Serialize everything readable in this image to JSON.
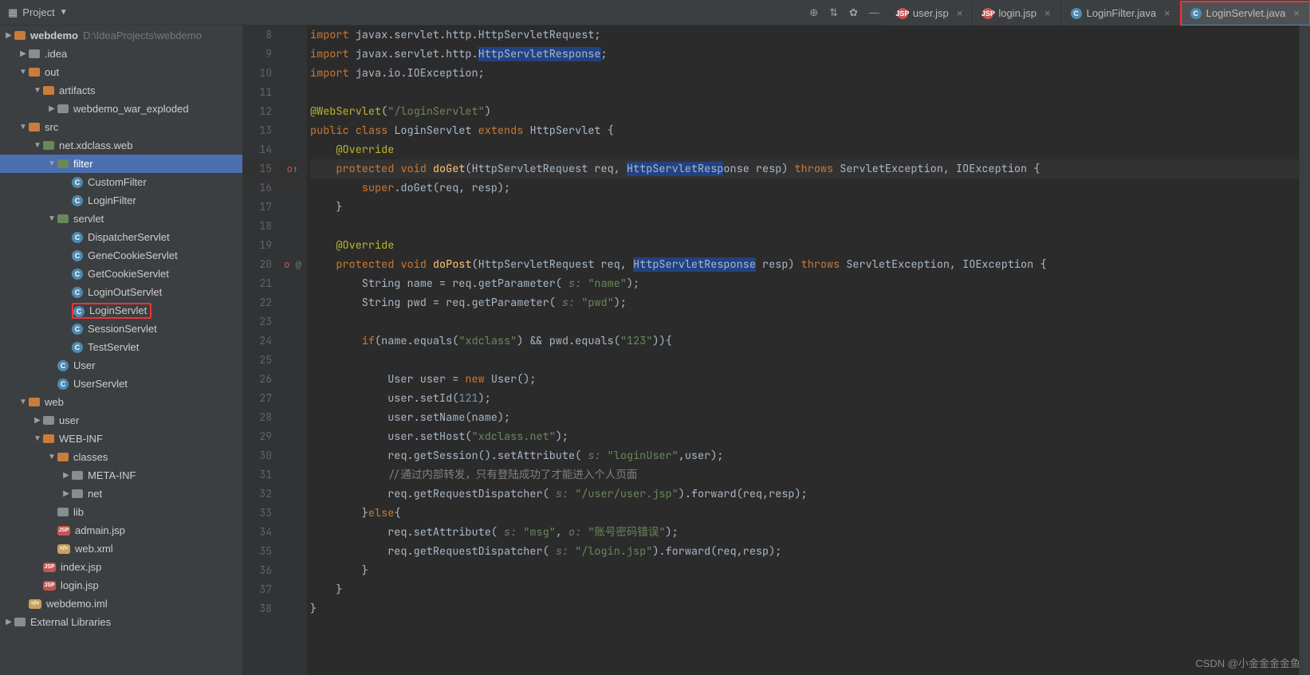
{
  "toolbar": {
    "project_label": "Project"
  },
  "tabs": [
    {
      "icon": "jsp",
      "label": "user.jsp"
    },
    {
      "icon": "jsp",
      "label": "login.jsp"
    },
    {
      "icon": "java",
      "label": "LoginFilter.java"
    },
    {
      "icon": "java",
      "label": "LoginServlet.java",
      "active": true,
      "highlight": true
    }
  ],
  "tree": {
    "root_name": "webdemo",
    "root_path": "D:\\IdeaProjects\\webdemo",
    "items": [
      ".idea",
      "out",
      "artifacts",
      "webdemo_war_exploded",
      "src",
      "net.xdclass.web",
      "filter",
      "CustomFilter",
      "LoginFilter",
      "servlet",
      "DispatcherServlet",
      "GeneCookieServlet",
      "GetCookieServlet",
      "LoginOutServlet",
      "LoginServlet",
      "SessionServlet",
      "TestServlet",
      "User",
      "UserServlet",
      "web",
      "user",
      "WEB-INF",
      "classes",
      "META-INF",
      "net",
      "lib",
      "admain.jsp",
      "web.xml",
      "index.jsp",
      "login.jsp",
      "webdemo.iml",
      "External Libraries"
    ]
  },
  "editor": {
    "line_start": 8,
    "lines": [
      [
        [
          "kw",
          "import "
        ],
        [
          "id",
          "javax.servlet.http.HttpServletRequest;"
        ]
      ],
      [
        [
          "kw",
          "import "
        ],
        [
          "id",
          "javax.servlet.http."
        ],
        [
          "hl",
          "HttpServletResponse"
        ],
        [
          "id",
          ";"
        ]
      ],
      [
        [
          "kw",
          "import "
        ],
        [
          "id",
          "java.io.IOException;"
        ]
      ],
      [
        [
          "id",
          ""
        ]
      ],
      [
        [
          "ann",
          "@WebServlet"
        ],
        [
          "id",
          "("
        ],
        [
          "str",
          "\"/loginServlet\""
        ],
        [
          "id",
          ")"
        ]
      ],
      [
        [
          "kw",
          "public class "
        ],
        [
          "id",
          "LoginServlet "
        ],
        [
          "kw",
          "extends "
        ],
        [
          "id",
          "HttpServlet {"
        ]
      ],
      [
        [
          "id",
          "    "
        ],
        [
          "ann",
          "@Override"
        ]
      ],
      [
        [
          "id",
          "    "
        ],
        [
          "kw",
          "protected void "
        ],
        [
          "fn",
          "doGet"
        ],
        [
          "id",
          "(HttpServletRequest req, "
        ],
        [
          "hl",
          "HttpServletResp"
        ],
        [
          "id",
          "onse resp) "
        ],
        [
          "kw",
          "throws "
        ],
        [
          "id",
          "ServletException, IOException {"
        ]
      ],
      [
        [
          "id",
          "        "
        ],
        [
          "kw",
          "super"
        ],
        [
          "id",
          ".doGet(req, resp);"
        ]
      ],
      [
        [
          "id",
          "    }"
        ]
      ],
      [
        [
          "id",
          ""
        ]
      ],
      [
        [
          "id",
          "    "
        ],
        [
          "ann",
          "@Override"
        ]
      ],
      [
        [
          "id",
          "    "
        ],
        [
          "kw",
          "protected void "
        ],
        [
          "fn",
          "doPost"
        ],
        [
          "id",
          "(HttpServletRequest req, "
        ],
        [
          "hl",
          "HttpServletResponse"
        ],
        [
          "id",
          " resp) "
        ],
        [
          "kw",
          "throws "
        ],
        [
          "id",
          "ServletException, IOException {"
        ]
      ],
      [
        [
          "id",
          "        String name = req.getParameter( "
        ],
        [
          "param",
          "s: "
        ],
        [
          "str",
          "\"name\""
        ],
        [
          "id",
          ");"
        ]
      ],
      [
        [
          "id",
          "        String pwd = req.getParameter( "
        ],
        [
          "param",
          "s: "
        ],
        [
          "str",
          "\"pwd\""
        ],
        [
          "id",
          ");"
        ]
      ],
      [
        [
          "id",
          ""
        ]
      ],
      [
        [
          "id",
          "        "
        ],
        [
          "kw",
          "if"
        ],
        [
          "id",
          "(name.equals("
        ],
        [
          "str",
          "\"xdclass\""
        ],
        [
          "id",
          ") && pwd.equals("
        ],
        [
          "str",
          "\"123\""
        ],
        [
          "id",
          ")){"
        ]
      ],
      [
        [
          "id",
          ""
        ]
      ],
      [
        [
          "id",
          "            User user = "
        ],
        [
          "kw",
          "new "
        ],
        [
          "id",
          "User();"
        ]
      ],
      [
        [
          "id",
          "            user.setId("
        ],
        [
          "num",
          "121"
        ],
        [
          "id",
          ");"
        ]
      ],
      [
        [
          "id",
          "            user.setName(name);"
        ]
      ],
      [
        [
          "id",
          "            user.setHost("
        ],
        [
          "str",
          "\"xdclass.net\""
        ],
        [
          "id",
          ");"
        ]
      ],
      [
        [
          "id",
          "            req.getSession().setAttribute( "
        ],
        [
          "param",
          "s: "
        ],
        [
          "str",
          "\"loginUser\""
        ],
        [
          "id",
          ",user);"
        ]
      ],
      [
        [
          "id",
          "            "
        ],
        [
          "cmt",
          "//通过内部转发，只有登陆成功了才能进入个人页面"
        ]
      ],
      [
        [
          "id",
          "            req.getRequestDispatcher( "
        ],
        [
          "param",
          "s: "
        ],
        [
          "str",
          "\"/user/user.jsp\""
        ],
        [
          "id",
          ").forward(req,resp);"
        ]
      ],
      [
        [
          "id",
          "        }"
        ],
        [
          "kw",
          "else"
        ],
        [
          "id",
          "{"
        ]
      ],
      [
        [
          "id",
          "            req.setAttribute( "
        ],
        [
          "param",
          "s: "
        ],
        [
          "str",
          "\"msg\""
        ],
        [
          "id",
          ", "
        ],
        [
          "param",
          "o: "
        ],
        [
          "str",
          "\"账号密码错误\""
        ],
        [
          "id",
          ");"
        ]
      ],
      [
        [
          "id",
          "            req.getRequestDispatcher( "
        ],
        [
          "param",
          "s: "
        ],
        [
          "str",
          "\"/login.jsp\""
        ],
        [
          "id",
          ").forward(req,resp);"
        ]
      ],
      [
        [
          "id",
          "        }"
        ]
      ],
      [
        [
          "id",
          "    }"
        ]
      ],
      [
        [
          "id",
          "}"
        ]
      ]
    ],
    "gutter_icons": {
      "15": "o↑",
      "20": "↑ @"
    }
  },
  "watermark": "CSDN @小金金金金鱼"
}
